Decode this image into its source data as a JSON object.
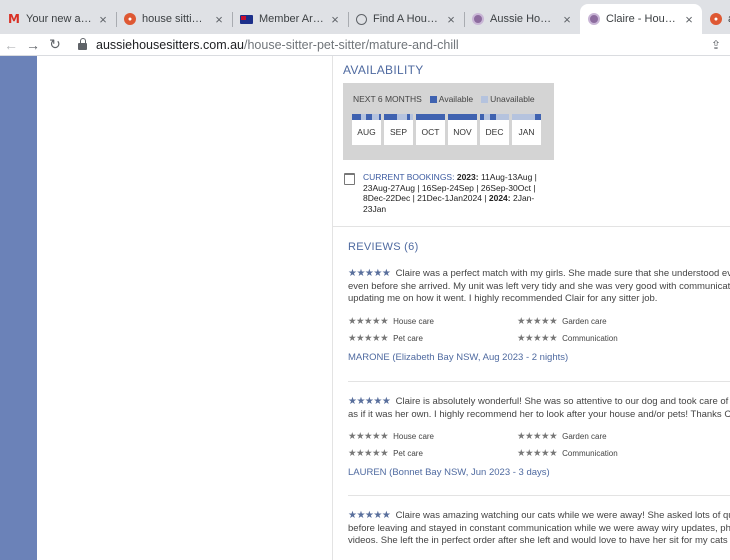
{
  "browser": {
    "tabs": [
      {
        "title": "Your new account",
        "favicon": "gmail-icon"
      },
      {
        "title": "house sitting at D",
        "favicon": "duckduckgo-icon"
      },
      {
        "title": "Member Area | M",
        "favicon": "australia-flag-icon"
      },
      {
        "title": "Find A House - H",
        "favicon": "globe-icon"
      },
      {
        "title": "Aussie House Sitt",
        "favicon": "aussie-house-sitters-icon"
      },
      {
        "title": "Claire - House sit",
        "favicon": "aussie-house-sitters-icon",
        "active": true
      },
      {
        "title": "appl",
        "favicon": "duckduckgo-icon"
      }
    ],
    "url_host": "aussiehousesitters.com.au",
    "url_path": "/house-sitter-pet-sitter/mature-and-chill"
  },
  "availability": {
    "title": "AVAILABILITY",
    "period_label": "NEXT 6 MONTHS",
    "legend_available": "Available",
    "legend_unavailable": "Unavailable",
    "colors": {
      "available": "#3f62b0",
      "unavailable": "#b5c3de"
    },
    "months": [
      {
        "label": "AUG",
        "available_ranges": [
          [
            0,
            0.3
          ],
          [
            0.47,
            0.7
          ],
          [
            0.92,
            1
          ]
        ]
      },
      {
        "label": "SEP",
        "available_ranges": [
          [
            0,
            0.45
          ],
          [
            0.8,
            0.88
          ]
        ]
      },
      {
        "label": "OCT",
        "available_ranges": [
          [
            0,
            1
          ]
        ]
      },
      {
        "label": "NOV",
        "available_ranges": [
          [
            0,
            1
          ]
        ]
      },
      {
        "label": "DEC",
        "available_ranges": [
          [
            0,
            0.15
          ],
          [
            0.35,
            0.55
          ]
        ]
      },
      {
        "label": "JAN",
        "available_ranges": [
          [
            0.78,
            1
          ]
        ]
      }
    ]
  },
  "bookings": {
    "label": "CURRENT BOOKINGS:",
    "year1": "2023:",
    "part1": " 11Aug-13Aug | 23Aug-27Aug | 16Sep-24Sep | 26Sep-30Oct | 8Dec-22Dec | 21Dec-1Jan2024 | ",
    "year2": "2024:",
    "part2": " 2Jan-23Jan"
  },
  "reviews": {
    "title": "REVIEWS (6)",
    "category_labels": [
      "House care",
      "Garden care",
      "Pet care",
      "Communication"
    ],
    "items": [
      {
        "stars": "★★★★★",
        "lines": [
          "Claire was a perfect match with my girls. She made sure that she understood eve",
          "even before she arrived. My unit was left very tidy and she was very good with communicating",
          "updating me on how it went. I highly recommended Clair for any sitter job."
        ],
        "ratings": [
          "★★★★★",
          "★★★★★",
          "★★★★★",
          "★★★★★"
        ],
        "reviewer": "MARONE (Elizabeth Bay NSW, Aug 2023 - 2 nights)"
      },
      {
        "stars": "★★★★★",
        "lines": [
          "Claire is absolutely wonderful! She was so attentive to our dog and took care of th",
          "as if it was her own. I highly recommend her to look after your house and/or pets! Thanks Clai"
        ],
        "ratings": [
          "★★★★★",
          "★★★★★",
          "★★★★★",
          "★★★★★"
        ],
        "reviewer": "LAUREN (Bonnet Bay NSW, Jun 2023 - 3 days)"
      },
      {
        "stars": "★★★★★",
        "lines": [
          "Claire was amazing watching our cats while we were away! She asked lots of ques",
          "before leaving and stayed in constant communication while we were away wiry updates, phot",
          "videos. She left the in perfect order after she left and would love to have her sit for my cats ag"
        ]
      }
    ]
  }
}
